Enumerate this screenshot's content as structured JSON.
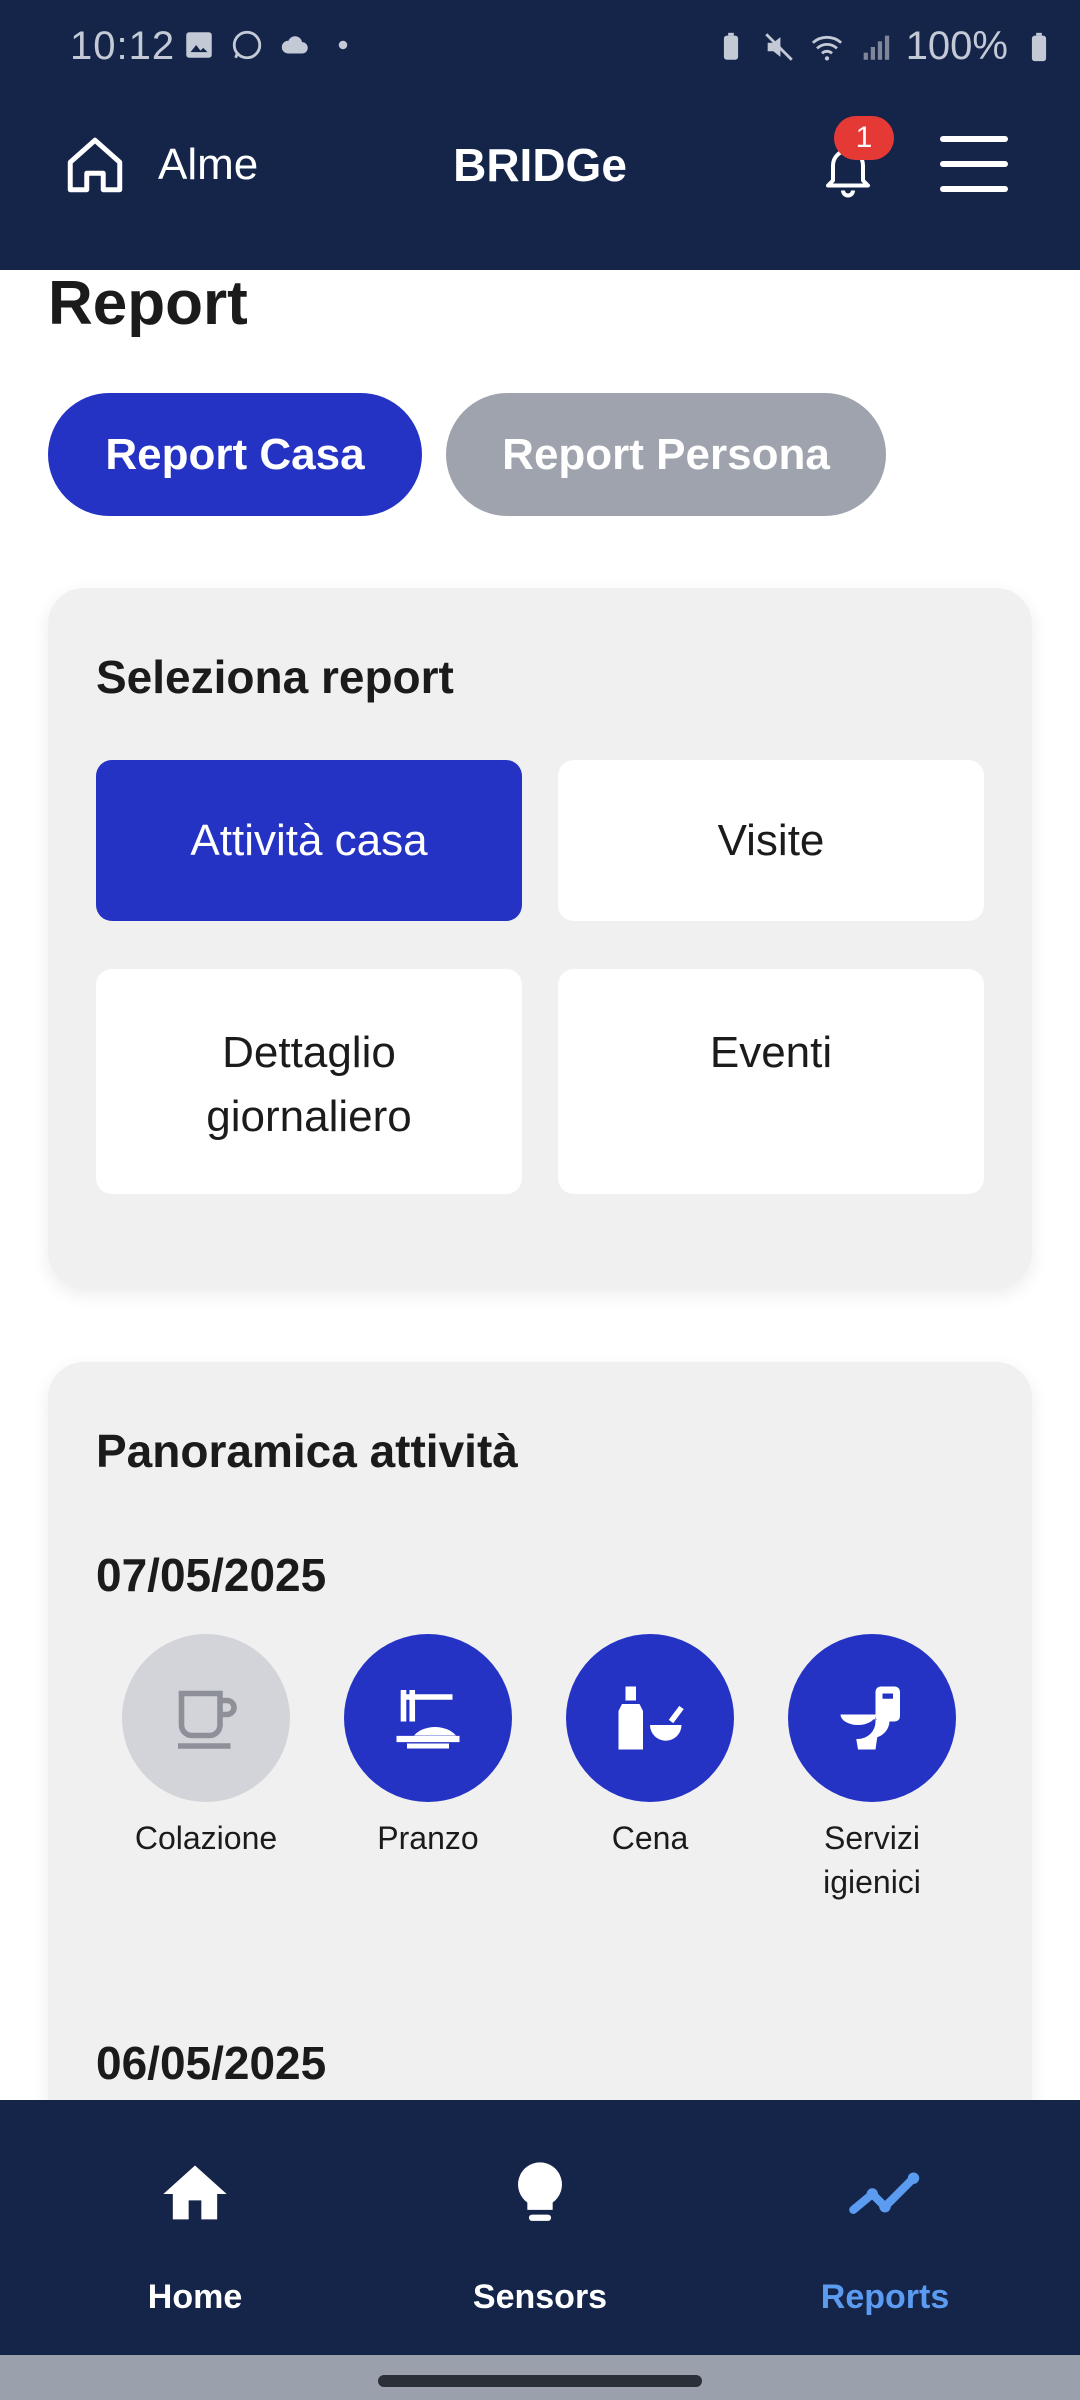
{
  "status_bar": {
    "time": "10:12",
    "battery": "100%"
  },
  "app_bar": {
    "location": "Alme",
    "title": "BRIDGe",
    "notification_count": "1"
  },
  "page": {
    "title": "Report",
    "tabs": [
      {
        "label": "Report Casa",
        "active": true
      },
      {
        "label": "Report Persona",
        "active": false
      }
    ]
  },
  "selector_card": {
    "title": "Seleziona report",
    "options": [
      {
        "label": "Attività casa",
        "active": true
      },
      {
        "label": "Visite",
        "active": false
      },
      {
        "label": "Dettaglio giornaliero",
        "active": false
      },
      {
        "label": "Eventi",
        "active": false
      }
    ]
  },
  "overview_card": {
    "title": "Panoramica attività",
    "days": [
      {
        "date": "07/05/2025",
        "activities": [
          {
            "label": "Colazione",
            "icon": "coffee-cup-icon",
            "done": false
          },
          {
            "label": "Pranzo",
            "icon": "lunch-plate-icon",
            "done": true
          },
          {
            "label": "Cena",
            "icon": "dinner-bottle-bowl-icon",
            "done": true
          },
          {
            "label": "Servizi igienici",
            "icon": "toilet-icon",
            "done": true
          }
        ]
      },
      {
        "date": "06/05/2025"
      }
    ]
  },
  "bottom_nav": {
    "items": [
      {
        "label": "Home",
        "icon": "home-icon",
        "active": false
      },
      {
        "label": "Sensors",
        "icon": "lightbulb-icon",
        "active": false
      },
      {
        "label": "Reports",
        "icon": "trend-line-icon",
        "active": true
      }
    ]
  },
  "colors": {
    "navy": "#15254a",
    "primary": "#2533c5",
    "inactive_pill": "#9ea3ad",
    "active_nav": "#5b9bf0",
    "badge": "#e53935"
  }
}
